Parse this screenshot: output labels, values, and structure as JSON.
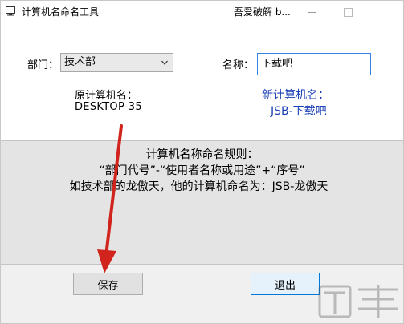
{
  "titlebar": {
    "title": "计算机名命名工具",
    "extra": "吾爱破解 b..."
  },
  "department": {
    "label": "部门：",
    "selected": "技术部"
  },
  "name": {
    "label": "名称：",
    "value": "下载吧"
  },
  "original": {
    "label": "原计算机名：",
    "value": "DESKTOP-35"
  },
  "new_name": {
    "label": "新计算机名：",
    "value": "JSB-下载吧"
  },
  "rules": {
    "heading": "计算机名称命名规则：",
    "line1": "“部门代号”-“使用者名称或用途”+“序号”",
    "line2": "如技术部的龙傲天，他的计算机命名为：JSB-龙傲天"
  },
  "buttons": {
    "save": "保存",
    "exit": "退出"
  },
  "colors": {
    "accent": "#1a3fb5",
    "input_border": "#2e86de",
    "arrow": "#d0241c"
  },
  "icons": {
    "app": "computer-icon",
    "minimize": "minimize-icon",
    "maximize": "maximize-icon",
    "dropdown": "chevron-down-icon"
  }
}
